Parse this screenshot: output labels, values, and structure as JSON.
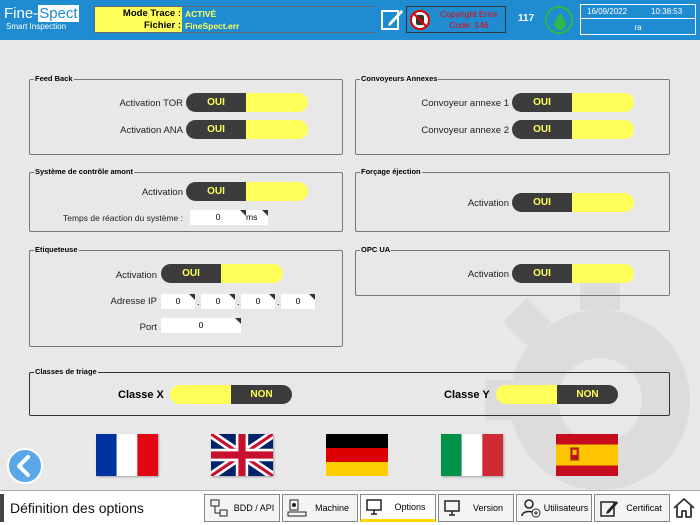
{
  "header": {
    "logo_left": "Fine-",
    "logo_right": "Spect",
    "logo_sub": "Smart Inspection",
    "mode_trace_label": "Mode Trace :",
    "fichier_label": "Fichier :",
    "mode_trace_value": "ACTIVÉ",
    "fichier_value": "FineSpect.err",
    "copyright_line1": "Copyright Error",
    "copyright_line2": "Code: 146",
    "counter": "117",
    "date": "16/09/2022",
    "time": "10:38:53",
    "user": "ra"
  },
  "feedback": {
    "title": "Feed Back",
    "tor_label": "Activation TOR",
    "tor_value": "OUI",
    "ana_label": "Activation ANA",
    "ana_value": "OUI"
  },
  "convoyeurs": {
    "title": "Convoyeurs Annexes",
    "c1_label": "Convoyeur annexe 1",
    "c1_value": "OUI",
    "c2_label": "Convoyeur annexe 2",
    "c2_value": "OUI"
  },
  "controle": {
    "title": "Système de contrôle amont",
    "act_label": "Activation",
    "act_value": "OUI",
    "temps_label": "Temps de réaction du système :",
    "temps_value": "0",
    "temps_unit": "ms"
  },
  "forcage": {
    "title": "Forçage éjection",
    "act_label": "Activation",
    "act_value": "OUI"
  },
  "etiqueteuse": {
    "title": "Etiqueteuse",
    "act_label": "Activation",
    "act_value": "OUI",
    "ip_label": "Adresse IP",
    "ip": [
      "0",
      "0",
      "0",
      "0"
    ],
    "port_label": "Port",
    "port_value": "0"
  },
  "opc": {
    "title": "OPC UA",
    "act_label": "Activation",
    "act_value": "OUI"
  },
  "classes": {
    "title": "Classes de triage",
    "x_label": "Classe X",
    "x_value": "NON",
    "y_label": "Classe Y",
    "y_value": "NON"
  },
  "footer": {
    "page_title": "Définition des options",
    "nav": [
      "BDD / API",
      "Machine",
      "Options",
      "Version",
      "Utilisateurs",
      "Certificat"
    ]
  },
  "colors": {
    "header_blue": "#1f8bd0",
    "toggle_yellow": "#ffff5a",
    "toggle_dark": "#3c3c3c"
  }
}
